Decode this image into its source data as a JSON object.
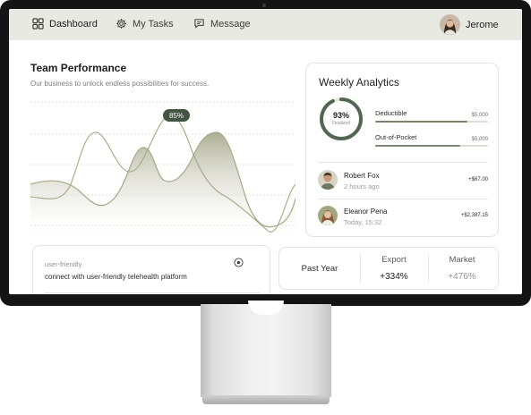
{
  "nav": {
    "items": [
      {
        "label": "Dashboard",
        "icon": "grid-icon"
      },
      {
        "label": "My Tasks",
        "icon": "gear-icon"
      },
      {
        "label": "Message",
        "icon": "chat-icon"
      }
    ],
    "active": "Dashboard"
  },
  "user": {
    "name": "Jerome",
    "avatar": "user-avatar"
  },
  "performance": {
    "title": "Team Performance",
    "subtitle": "Our business to unlock endless possibilities for success.",
    "peak_badge": "85%"
  },
  "analytics": {
    "title": "Weekly Analytics",
    "donut": {
      "percent": "93%",
      "label": "Finalized",
      "fraction": 0.93
    },
    "bars": [
      {
        "label": "Deductible",
        "value": "$5,000",
        "fill": 0.82
      },
      {
        "label": "Out-of-Pocket",
        "value": "$5,000",
        "fill": 0.75
      }
    ],
    "people": [
      {
        "name": "Robert Fox",
        "time": "2 hours ago",
        "amount": "+$67.00"
      },
      {
        "name": "Eleanor Pena",
        "time": "Today, 15:32",
        "amount": "+$2,387.15"
      }
    ]
  },
  "note": {
    "label": "user-friendly",
    "text": "connect with user-friendly telehealth platform"
  },
  "stats": {
    "period": "Past Year",
    "columns": [
      {
        "label": "Export",
        "value": "+334%"
      },
      {
        "label": "Market",
        "value": "+476%"
      }
    ]
  },
  "colors": {
    "accent": "#435443",
    "area_fill": "#b8b9a4",
    "line": "#a5a882",
    "topbar": "#e7e9e2"
  }
}
